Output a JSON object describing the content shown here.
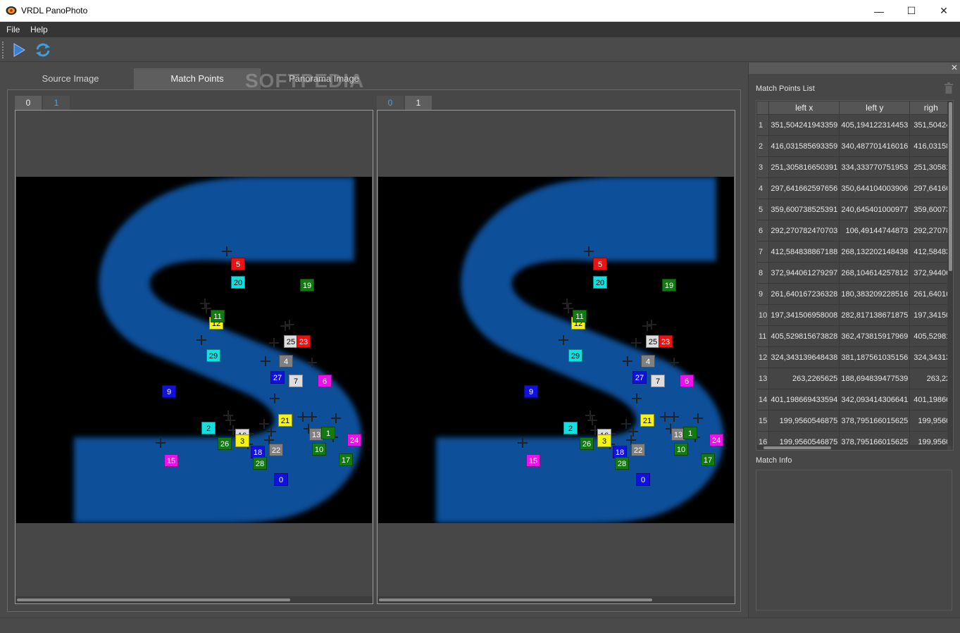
{
  "window": {
    "title": "VRDL PanoPhoto",
    "controls": {
      "minimize": "—",
      "maximize": "☐",
      "close": "✕"
    }
  },
  "menu": {
    "file": "File",
    "help": "Help"
  },
  "toolbar": {
    "play_icon": "play-icon",
    "refresh_icon": "refresh-icon"
  },
  "tabs": [
    "Source Image",
    "Match Points",
    "Panorama Image"
  ],
  "active_tab": "Match Points",
  "watermark": "SOFTPEDIA",
  "left_view": {
    "tabs": [
      "0",
      "1"
    ],
    "active": "0"
  },
  "right_view": {
    "tabs": [
      "0",
      "1"
    ],
    "active": "1"
  },
  "markers": [
    {
      "id": "5",
      "color": "#ee1111"
    },
    {
      "id": "20",
      "color": "#11e0e0"
    },
    {
      "id": "19",
      "color": "#117a11"
    },
    {
      "id": "12",
      "color": "#f5f511"
    },
    {
      "id": "25",
      "color": "#dddddd"
    },
    {
      "id": "23",
      "color": "#ee1111"
    },
    {
      "id": "29",
      "color": "#11e0e0"
    },
    {
      "id": "4",
      "color": "#808080"
    },
    {
      "id": "27",
      "color": "#1111dd"
    },
    {
      "id": "7",
      "color": "#dddddd"
    },
    {
      "id": "6",
      "color": "#ee11ee"
    },
    {
      "id": "9",
      "color": "#1111dd"
    },
    {
      "id": "21",
      "color": "#f5f511"
    },
    {
      "id": "2",
      "color": "#11e0e0"
    },
    {
      "id": "16",
      "color": "#dddddd"
    },
    {
      "id": "26",
      "color": "#117a11"
    },
    {
      "id": "3",
      "color": "#f5f511"
    },
    {
      "id": "13",
      "color": "#808080"
    },
    {
      "id": "1",
      "color": "#117a11"
    },
    {
      "id": "24",
      "color": "#ee11ee"
    },
    {
      "id": "18",
      "color": "#1111dd"
    },
    {
      "id": "22",
      "color": "#808080"
    },
    {
      "id": "10",
      "color": "#117a11"
    },
    {
      "id": "15",
      "color": "#ee11ee"
    },
    {
      "id": "28",
      "color": "#117a11"
    },
    {
      "id": "17",
      "color": "#117a11"
    },
    {
      "id": "0",
      "color": "#1111dd"
    },
    {
      "id": "11",
      "color": "#117a11"
    }
  ],
  "match_points_list": {
    "label": "Match Points List",
    "trash_icon": "trash-icon",
    "columns": [
      "left x",
      "left y",
      "right x"
    ],
    "columns_visible": [
      "left x",
      "left y",
      "righ"
    ],
    "rows": [
      [
        "1",
        "351,504241943359",
        "405,194122314453",
        "351,50424"
      ],
      [
        "2",
        "416,031585693359",
        "340,487701416016",
        "416,03158"
      ],
      [
        "3",
        "251,305816650391",
        "334,333770751953",
        "251,30581"
      ],
      [
        "4",
        "297,641662597656",
        "350,644104003906",
        "297,64166"
      ],
      [
        "5",
        "359,600738525391",
        "240,645401000977",
        "359,60073"
      ],
      [
        "6",
        "292,270782470703",
        "106,49144744873",
        "292,27078"
      ],
      [
        "7",
        "412,584838867188",
        "268,132202148438",
        "412,58483"
      ],
      [
        "8",
        "372,944061279297",
        "268,104614257812",
        "372,94406"
      ],
      [
        "9",
        "261,640167236328",
        "180,383209228516",
        "261,64016"
      ],
      [
        "10",
        "197,341506958008",
        "282,817138671875",
        "197,34150"
      ],
      [
        "11",
        "405,529815673828",
        "362,473815917969",
        "405,52981"
      ],
      [
        "12",
        "324,343139648438",
        "381,187561035156",
        "324,34313"
      ],
      [
        "13",
        "263,2265625",
        "188,694839477539",
        "263,22"
      ],
      [
        "14",
        "401,198669433594",
        "342,093414306641",
        "401,19866"
      ],
      [
        "15",
        "199,9560546875",
        "378,795166015625",
        "199,9560"
      ],
      [
        "16",
        "199,9560546875",
        "378,795166015625",
        "199,9560"
      ]
    ]
  },
  "match_info": {
    "label": "Match Info"
  }
}
